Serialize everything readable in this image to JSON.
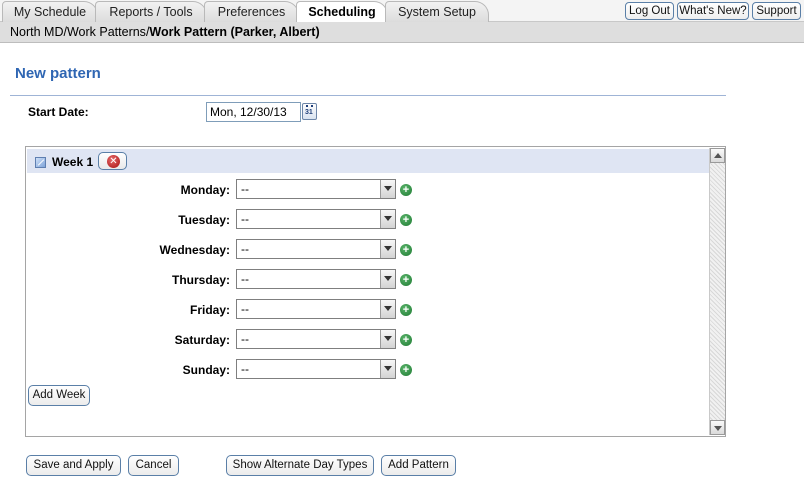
{
  "tabs": [
    {
      "label": "My Schedule"
    },
    {
      "label": "Reports / Tools"
    },
    {
      "label": "Preferences"
    },
    {
      "label": "Scheduling",
      "active": true
    },
    {
      "label": "System Setup"
    }
  ],
  "top_buttons": {
    "logout": "Log Out",
    "whatsnew": "What's New?",
    "support": "Support"
  },
  "breadcrumb": {
    "parts": [
      "North MD",
      "Work Patterns"
    ],
    "separator": "/",
    "current": "Work Pattern (Parker, Albert)"
  },
  "page_title": "New pattern",
  "start_date": {
    "label": "Start Date:",
    "value": "Mon, 12/30/13",
    "calendar_icon_text": "31"
  },
  "week": {
    "label": "Week 1",
    "days": [
      {
        "label": "Monday:",
        "value": "--"
      },
      {
        "label": "Tuesday:",
        "value": "--"
      },
      {
        "label": "Wednesday:",
        "value": "--"
      },
      {
        "label": "Thursday:",
        "value": "--"
      },
      {
        "label": "Friday:",
        "value": "--"
      },
      {
        "label": "Saturday:",
        "value": "--"
      },
      {
        "label": "Sunday:",
        "value": "--"
      }
    ],
    "add_week_label": "Add Week"
  },
  "actions": {
    "save_apply": "Save and Apply",
    "cancel": "Cancel",
    "show_alternate": "Show Alternate Day Types",
    "add_pattern": "Add Pattern"
  },
  "colors": {
    "title_blue": "#2f66b3",
    "week_header_bg": "#dfe5f3",
    "button_border": "#5a7fa7",
    "add_green": "#1e7a33",
    "remove_red": "#a51010"
  }
}
